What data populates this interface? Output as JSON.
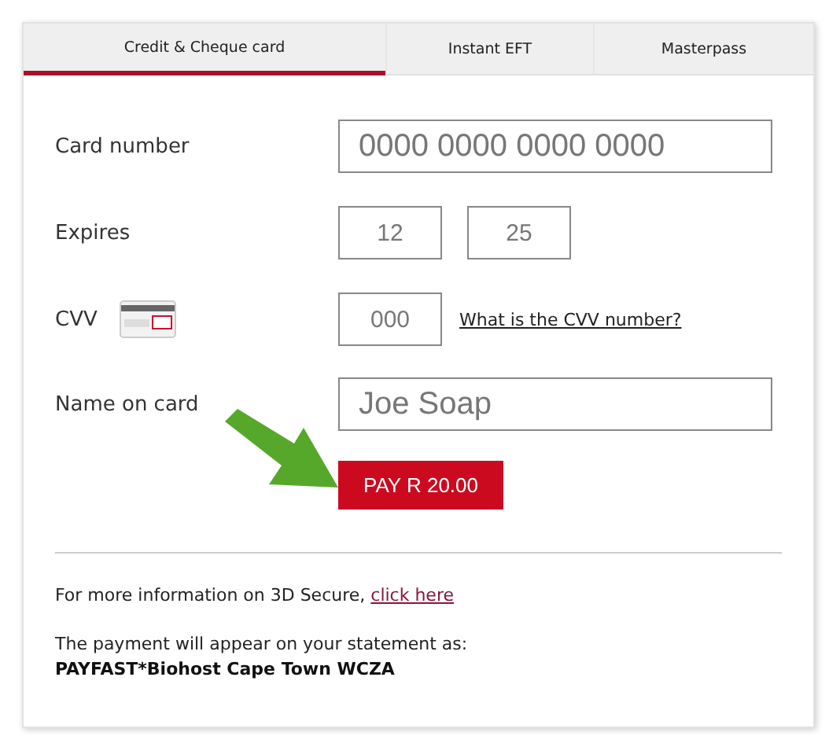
{
  "tabs": [
    {
      "label": "Credit & Cheque card",
      "selected": true
    },
    {
      "label": "Instant EFT",
      "selected": false
    },
    {
      "label": "Masterpass",
      "selected": false
    }
  ],
  "form": {
    "card_number": {
      "label": "Card number",
      "value": "0000 0000 0000 0000"
    },
    "expires": {
      "label": "Expires",
      "month": "12",
      "year": "25"
    },
    "cvv": {
      "label": "CVV",
      "value": "000",
      "help_link": "What is the CVV number?"
    },
    "name": {
      "label": "Name on card",
      "value": "Joe Soap"
    },
    "pay_button": "PAY R 20.00"
  },
  "info": {
    "text": "For more information on 3D Secure,",
    "link": "click here"
  },
  "statement": {
    "text": "The payment will appear on your statement as:",
    "descriptor": "PAYFAST*Biohost Cape Town WCZA"
  }
}
